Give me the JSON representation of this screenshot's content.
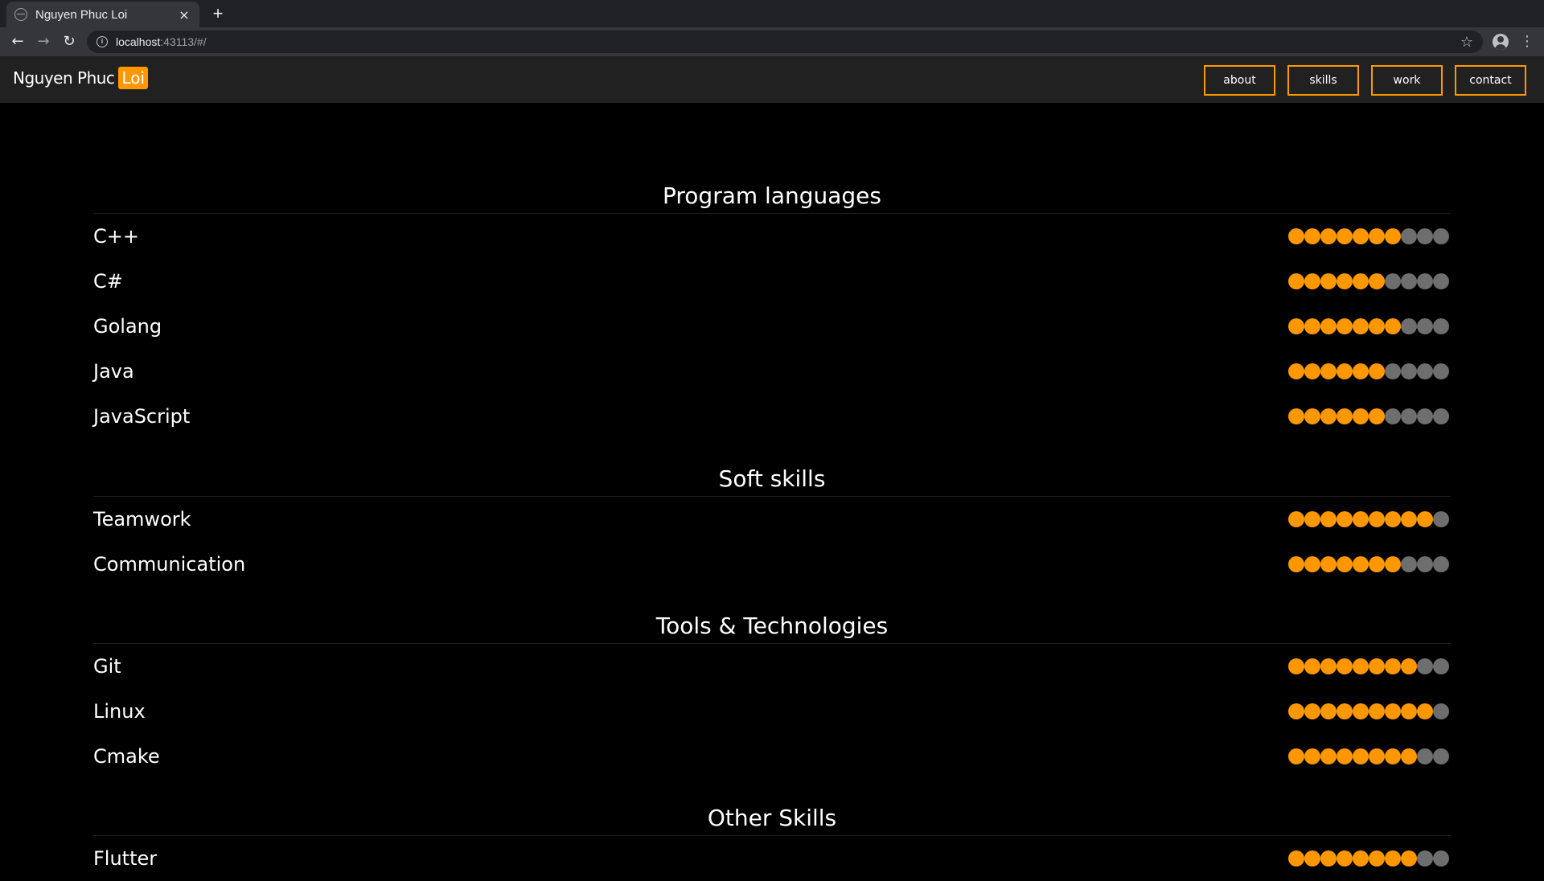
{
  "browser": {
    "tab_title": "Nguyen Phuc Loi",
    "tab_close": "×",
    "new_tab": "+",
    "back": "←",
    "forward": "→",
    "reload": "↻",
    "url_host": "localhost",
    "url_rest": ":43113/#/",
    "info_icon": "i",
    "star": "☆",
    "menu": "⋮"
  },
  "site": {
    "brand_name": "Nguyen Phuc",
    "brand_accent": "Loi",
    "nav": [
      "about",
      "skills",
      "work",
      "contact"
    ],
    "accent_color": "#ff9800",
    "dot_off_color": "#6e6e6e"
  },
  "sections": [
    {
      "title": "Program languages",
      "skills": [
        {
          "name": "C++",
          "level": 7,
          "max": 10
        },
        {
          "name": "C#",
          "level": 6,
          "max": 10
        },
        {
          "name": "Golang",
          "level": 7,
          "max": 10
        },
        {
          "name": "Java",
          "level": 6,
          "max": 10
        },
        {
          "name": "JavaScript",
          "level": 6,
          "max": 10
        }
      ]
    },
    {
      "title": "Soft skills",
      "skills": [
        {
          "name": "Teamwork",
          "level": 9,
          "max": 10
        },
        {
          "name": "Communication",
          "level": 7,
          "max": 10
        }
      ]
    },
    {
      "title": "Tools & Technologies",
      "skills": [
        {
          "name": "Git",
          "level": 8,
          "max": 10
        },
        {
          "name": "Linux",
          "level": 9,
          "max": 10
        },
        {
          "name": "Cmake",
          "level": 8,
          "max": 10
        }
      ]
    },
    {
      "title": "Other Skills",
      "skills": [
        {
          "name": "Flutter",
          "level": 8,
          "max": 10
        }
      ]
    }
  ]
}
